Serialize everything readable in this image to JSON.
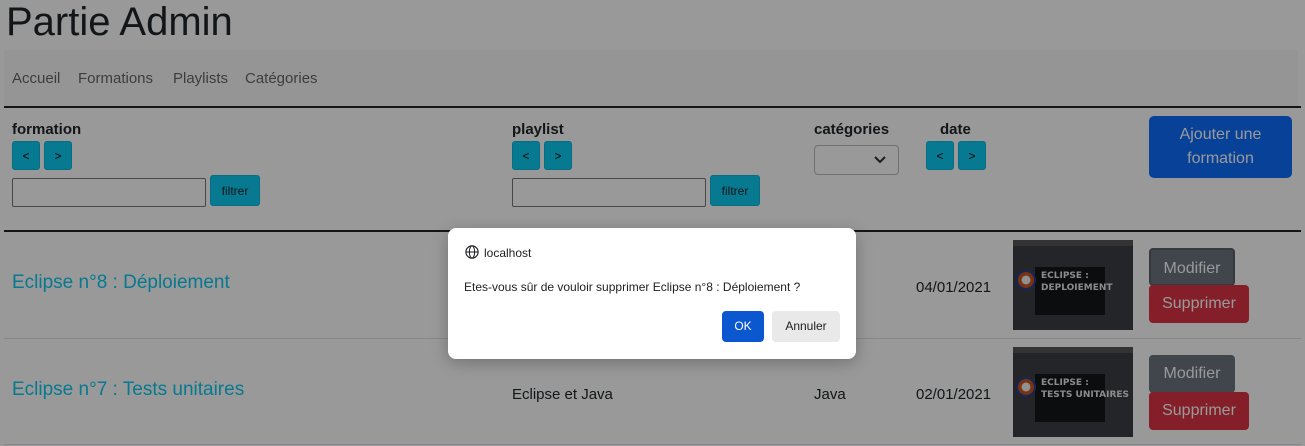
{
  "page": {
    "title": "Partie Admin"
  },
  "nav": {
    "items": [
      "Accueil",
      "Formations",
      "Playlists",
      "Catégories"
    ]
  },
  "filters": {
    "formation_label": "formation",
    "playlist_label": "playlist",
    "categories_label": "catégories",
    "date_label": "date",
    "prev_glyph": "<",
    "next_glyph": ">",
    "filter_button": "filtrer",
    "formation_value": "",
    "playlist_value": "",
    "category_selected": ""
  },
  "actions": {
    "add_formation": "Ajouter une formation"
  },
  "rows": [
    {
      "title": "Eclipse n°8 : Déploiement",
      "playlist": "",
      "category": "",
      "date": "04/01/2021",
      "thumb_text": [
        "ECLIPSE :",
        "DEPLOIEMENT"
      ],
      "modify": "Modifier",
      "delete": "Supprimer"
    },
    {
      "title": "Eclipse n°7 : Tests unitaires",
      "playlist": "Eclipse et Java",
      "category": "Java",
      "date": "02/01/2021",
      "thumb_text": [
        "ECLIPSE :",
        "TESTS UNITAIRES"
      ],
      "modify": "Modifier",
      "delete": "Supprimer"
    }
  ],
  "dialog": {
    "host": "localhost",
    "message": "Etes-vous sûr de vouloir supprimer Eclipse n°8 : Déploiement ?",
    "ok": "OK",
    "cancel": "Annuler"
  },
  "colors": {
    "link": "#0dcaf0",
    "primary": "#0d6efd",
    "danger": "#dc3545",
    "secondary": "#6c757d",
    "dialog_ok": "#0b57d0"
  },
  "icons": {
    "dialog_host": "globe-icon",
    "select_arrow": "chevron-down-icon"
  }
}
